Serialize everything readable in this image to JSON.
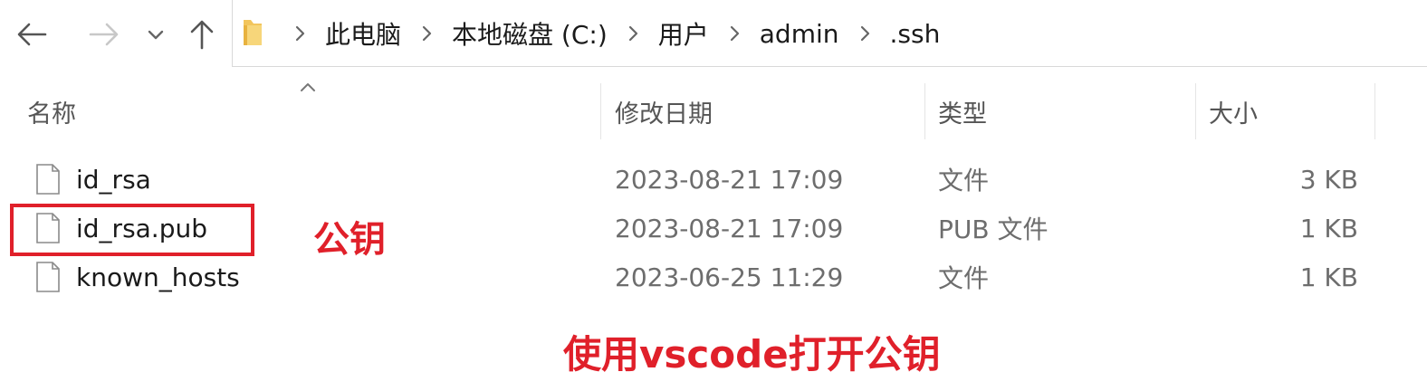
{
  "navigation": {
    "back_icon": "arrow-left-icon",
    "forward_icon": "arrow-right-icon",
    "recent_icon": "chevron-down-icon",
    "up_icon": "arrow-up-icon"
  },
  "address_bar": {
    "folder_icon": "folder-icon",
    "breadcrumbs": [
      "此电脑",
      "本地磁盘 (C:)",
      "用户",
      "admin",
      ".ssh"
    ]
  },
  "columns": {
    "name": "名称",
    "modified": "修改日期",
    "type": "类型",
    "size": "大小"
  },
  "files": [
    {
      "name": "id_rsa",
      "modified": "2023-08-21 17:09",
      "type": "文件",
      "size": "3 KB",
      "icon": "file-icon"
    },
    {
      "name": "id_rsa.pub",
      "modified": "2023-08-21 17:09",
      "type": "PUB 文件",
      "size": "1 KB",
      "icon": "file-icon"
    },
    {
      "name": "known_hosts",
      "modified": "2023-06-25 11:29",
      "type": "文件",
      "size": "1 KB",
      "icon": "file-icon"
    }
  ],
  "annotations": {
    "public_key_label": "公钥",
    "instruction": "使用vscode打开公钥",
    "color": "#e0202a"
  }
}
